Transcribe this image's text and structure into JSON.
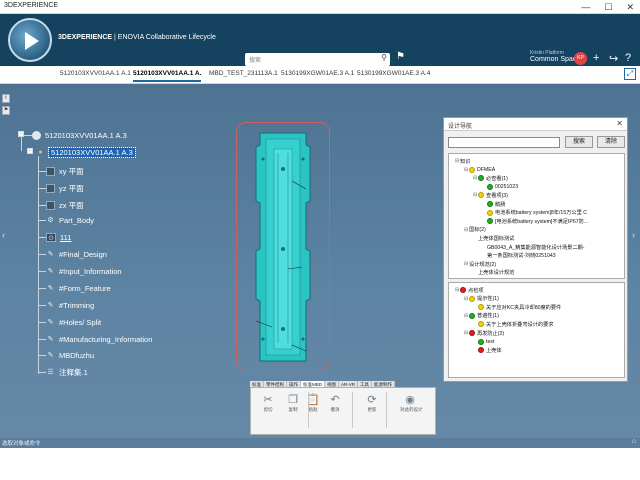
{
  "app": {
    "window_title": "3DEXPERIENCE",
    "brand_strong": "3DEXPERIENCE",
    "brand_rest": " | ENOVIA Collaborative Lifecycle",
    "search_placeholder": "搜索",
    "user_top": "Kristin Platform",
    "user_space": "Common Space",
    "avatar_initials": "KP"
  },
  "tabs": [
    {
      "label": "5120103XVV01AA.1 A.1",
      "active": false
    },
    {
      "label": "5120103XVV01AA.1 A.",
      "active": true
    },
    {
      "label": "MBD_TEST_231113A.1",
      "active": false
    },
    {
      "label": "5130199XGW01AE.3 A.1",
      "active": false
    },
    {
      "label": "5130199XGW01AE.3 A.4",
      "active": false
    }
  ],
  "tree": {
    "root": "5120103XVV01AA.1 A.3",
    "selected": "5120103XVV01AA.1 A.3",
    "children": [
      {
        "label": "xy 平面",
        "icon": "plane-icon"
      },
      {
        "label": "yz 平面",
        "icon": "plane-icon"
      },
      {
        "label": "zx 平面",
        "icon": "plane-icon"
      },
      {
        "label": "Part_Body",
        "icon": "body-icon"
      },
      {
        "label": "111",
        "icon": "sketch-icon"
      },
      {
        "label": "#Final_Design",
        "icon": "geoset-icon"
      },
      {
        "label": "#Input_Information",
        "icon": "geoset-icon"
      },
      {
        "label": "#Form_Feature",
        "icon": "geoset-icon"
      },
      {
        "label": "#Trimming",
        "icon": "geoset-icon"
      },
      {
        "label": "#Holes/ Split",
        "icon": "geoset-icon"
      },
      {
        "label": "#Manufacturing_Information",
        "icon": "geoset-icon"
      },
      {
        "label": "MBDfuzhu",
        "icon": "geoset-icon"
      },
      {
        "label": "注释集.1",
        "icon": "annotation-icon"
      }
    ]
  },
  "dialog": {
    "title": "设计导航",
    "search_btn": "搜索",
    "clear_btn": "清除",
    "top_tree": [
      {
        "level": 0,
        "toggle": "⊟",
        "dot": "",
        "label": "知识"
      },
      {
        "level": 1,
        "toggle": "⊟",
        "dot": "y",
        "label": "DFMEA"
      },
      {
        "level": 2,
        "toggle": "⊟",
        "dot": "g",
        "label": "必查看(1)"
      },
      {
        "level": 3,
        "toggle": "",
        "dot": "g",
        "label": "00251023"
      },
      {
        "level": 2,
        "toggle": "⊟",
        "dot": "y",
        "label": "查看项(3)"
      },
      {
        "level": 3,
        "toggle": "",
        "dot": "g",
        "label": "鹅肠"
      },
      {
        "level": 3,
        "toggle": "",
        "dot": "y",
        "label": "电池系统battery system]8年/15万公里 C"
      },
      {
        "level": 3,
        "toggle": "",
        "dot": "g",
        "label": "[电池系统battery system]不满足IP67防..."
      },
      {
        "level": 1,
        "toggle": "⊟",
        "dot": "",
        "label": "国标(2)"
      },
      {
        "level": 2,
        "toggle": "",
        "dot": "",
        "label": "上壳体国标测试"
      },
      {
        "level": 3,
        "toggle": "",
        "dot": "",
        "label": "GB0043_A_精集能源智能化设计场景二期-"
      },
      {
        "level": 3,
        "toggle": "",
        "dot": "",
        "label": "第一条国标测试-刘晓0251043"
      },
      {
        "level": 1,
        "toggle": "⊟",
        "dot": "",
        "label": "设计规范(2)"
      },
      {
        "level": 2,
        "toggle": "",
        "dot": "",
        "label": "上壳体设计规范"
      }
    ],
    "bottom_tree": [
      {
        "level": 0,
        "toggle": "⊟",
        "dot": "r",
        "label": "点检项"
      },
      {
        "level": 1,
        "toggle": "⊟",
        "dot": "y",
        "label": "提示性(1)"
      },
      {
        "level": 2,
        "toggle": "",
        "dot": "y",
        "label": "关于应对KC夹具冷却80度的要件"
      },
      {
        "level": 1,
        "toggle": "⊟",
        "dot": "g",
        "label": "普遍性(1)"
      },
      {
        "level": 2,
        "toggle": "",
        "dot": "y",
        "label": "关于上壳体折叠弯设计的要求"
      },
      {
        "level": 1,
        "toggle": "⊟",
        "dot": "r",
        "label": "再发防止(2)"
      },
      {
        "level": 2,
        "toggle": "",
        "dot": "g",
        "label": "test"
      },
      {
        "level": 2,
        "toggle": "",
        "dot": "r",
        "label": "上壳体"
      }
    ]
  },
  "actionbar": {
    "tabs": [
      "标准",
      "零件结构",
      "操作",
      "标准MBD",
      "视图",
      "AR-VR",
      "工具",
      "能源制作"
    ],
    "active_tab": 3,
    "buttons": [
      {
        "icon": "cut-icon",
        "glyph": "✂",
        "label": "剪切"
      },
      {
        "icon": "copy-icon",
        "glyph": "❐",
        "label": "复制"
      },
      {
        "icon": "paste-icon",
        "glyph": "📋",
        "label": "粘贴"
      },
      {
        "icon": "undo-icon",
        "glyph": "↶",
        "label": "撤消"
      },
      {
        "icon": "update-icon",
        "glyph": "⟳",
        "label": "更新"
      },
      {
        "icon": "design-nav-icon",
        "glyph": "◉",
        "label": "对此的设计"
      }
    ]
  },
  "statusbar": {
    "text": "选取对象或命令"
  },
  "colors": {
    "header": "#15425f",
    "viewport": "#5e84a3",
    "part": "#2bc4c4",
    "selection": "#1f64b4"
  }
}
